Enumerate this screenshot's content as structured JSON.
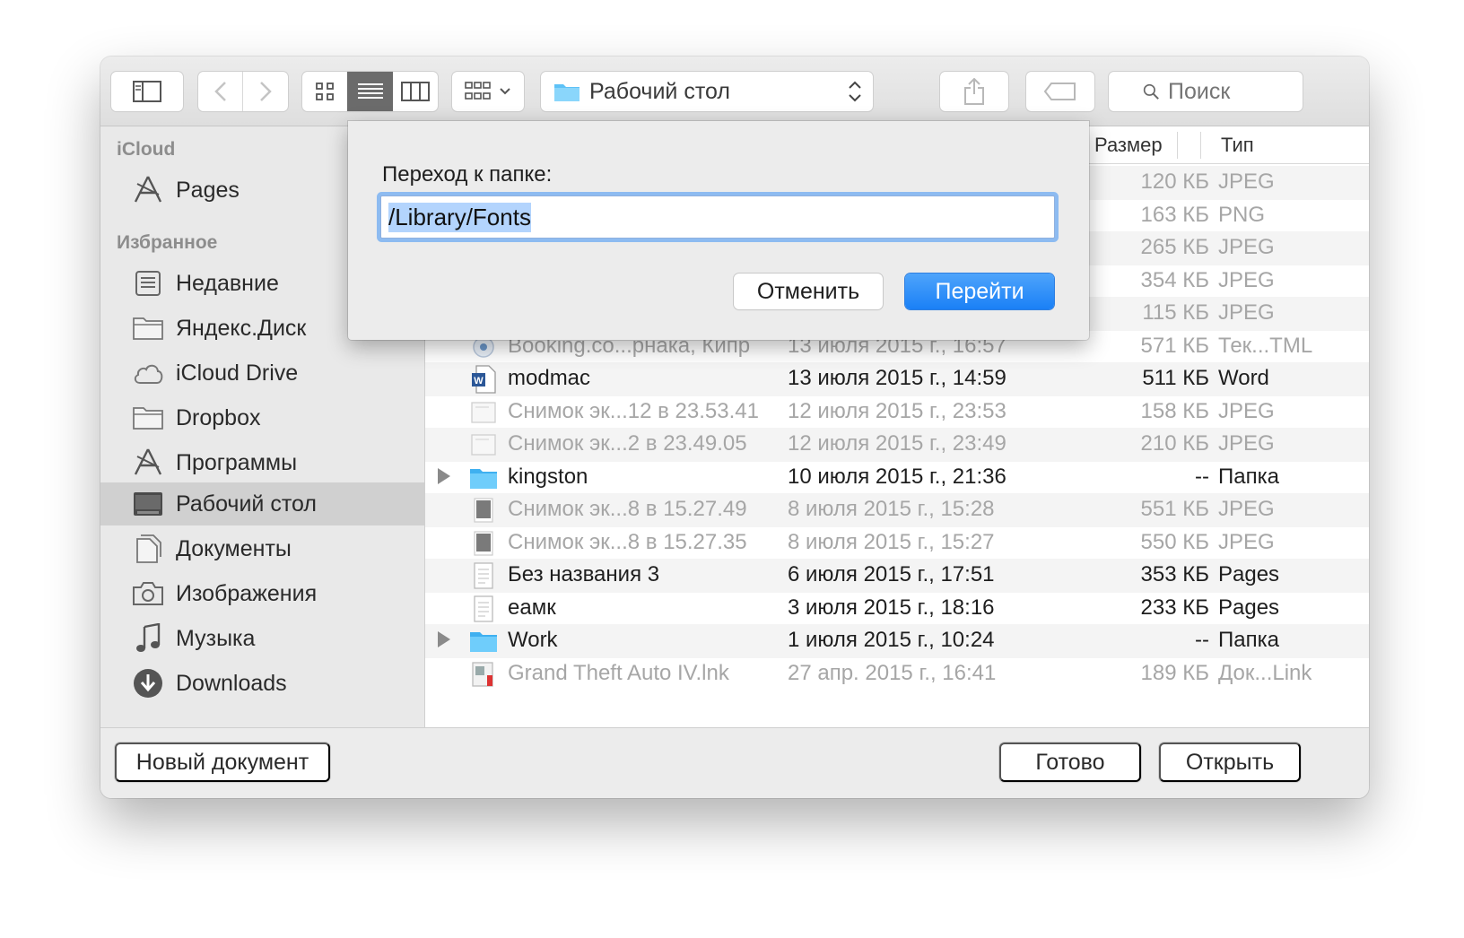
{
  "toolbar": {
    "path_label": "Рабочий стол",
    "search_placeholder": "Поиск"
  },
  "sidebar": {
    "sections": [
      {
        "label": "iCloud",
        "items": [
          {
            "label": "Pages",
            "icon": "pages-app-icon"
          }
        ]
      },
      {
        "label": "Избранное",
        "items": [
          {
            "label": "Недавние",
            "icon": "recents-icon"
          },
          {
            "label": "Яндекс.Диск",
            "icon": "folder-icon"
          },
          {
            "label": "iCloud Drive",
            "icon": "cloud-icon"
          },
          {
            "label": "Dropbox",
            "icon": "folder-icon"
          },
          {
            "label": "Программы",
            "icon": "applications-icon"
          },
          {
            "label": "Рабочий стол",
            "icon": "desktop-icon",
            "selected": true
          },
          {
            "label": "Документы",
            "icon": "documents-icon"
          },
          {
            "label": "Изображения",
            "icon": "camera-icon"
          },
          {
            "label": "Музыка",
            "icon": "music-note-icon"
          },
          {
            "label": "Downloads",
            "icon": "download-icon"
          }
        ]
      }
    ]
  },
  "list": {
    "columns": {
      "size": "Размер",
      "type": "Тип"
    },
    "rows": [
      {
        "name": "",
        "date": "",
        "size": "120 КБ",
        "type": "JPEG",
        "icon": "",
        "enabled": false
      },
      {
        "name": "",
        "date": "",
        "size": "163 КБ",
        "type": "PNG",
        "icon": "",
        "enabled": false
      },
      {
        "name": "",
        "date": "",
        "size": "265 КБ",
        "type": "JPEG",
        "icon": "",
        "enabled": false
      },
      {
        "name": "",
        "date": "",
        "size": "354 КБ",
        "type": "JPEG",
        "icon": "",
        "enabled": false
      },
      {
        "name": "",
        "date": "",
        "size": "115 КБ",
        "type": "JPEG",
        "icon": "",
        "enabled": false
      },
      {
        "name": "Booking.co...рнака, Кипр",
        "date": "13 июля 2015 г., 16:57",
        "size": "571 КБ",
        "type": "Тек...TML",
        "icon": "webloc-icon",
        "enabled": false
      },
      {
        "name": "modmac",
        "date": "13 июля 2015 г., 14:59",
        "size": "511 КБ",
        "type": "Word",
        "icon": "word-doc-icon",
        "enabled": true
      },
      {
        "name": "Снимок эк...12 в 23.53.41",
        "date": "12 июля 2015 г., 23:53",
        "size": "158 КБ",
        "type": "JPEG",
        "icon": "image-file-icon",
        "enabled": false
      },
      {
        "name": "Снимок эк...2 в 23.49.05",
        "date": "12 июля 2015 г., 23:49",
        "size": "210 КБ",
        "type": "JPEG",
        "icon": "image-file-icon",
        "enabled": false
      },
      {
        "name": "kingston",
        "date": "10 июля 2015 г., 21:36",
        "size": "--",
        "type": "Папка",
        "icon": "blue-folder-icon",
        "enabled": true,
        "folder": true
      },
      {
        "name": "Снимок эк...8 в 15.27.49",
        "date": "8 июля 2015 г., 15:28",
        "size": "551 КБ",
        "type": "JPEG",
        "icon": "dark-image-file-icon",
        "enabled": false
      },
      {
        "name": "Снимок эк...8 в 15.27.35",
        "date": "8 июля 2015 г., 15:27",
        "size": "550 КБ",
        "type": "JPEG",
        "icon": "dark-image-file-icon",
        "enabled": false
      },
      {
        "name": "Без названия 3",
        "date": "6 июля 2015 г., 17:51",
        "size": "353 КБ",
        "type": "Pages",
        "icon": "pages-doc-icon",
        "enabled": true
      },
      {
        "name": "еамк",
        "date": "3 июля 2015 г., 18:16",
        "size": "233 КБ",
        "type": "Pages",
        "icon": "pages-doc-icon",
        "enabled": true
      },
      {
        "name": "Work",
        "date": "1 июля 2015 г., 10:24",
        "size": "--",
        "type": "Папка",
        "icon": "blue-folder-icon",
        "enabled": true,
        "folder": true
      },
      {
        "name": "Grand Theft Auto IV.lnk",
        "date": "27 апр. 2015 г., 16:41",
        "size": "189 КБ",
        "type": "Док...Link",
        "icon": "shortcut-file-icon",
        "enabled": false
      }
    ]
  },
  "bottom": {
    "new_doc": "Новый документ",
    "done": "Готово",
    "open": "Открыть"
  },
  "goto_sheet": {
    "title": "Переход к папке:",
    "path_value": "/Library/Fonts",
    "cancel": "Отменить",
    "go": "Перейти"
  },
  "colors": {
    "accent": "#1a80f6",
    "folder_blue": "#5ec2f7",
    "selection": "#b3d4fd"
  }
}
